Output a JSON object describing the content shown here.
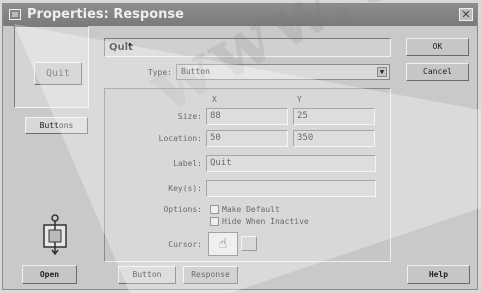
{
  "window": {
    "title": "Properties: Response",
    "close_glyph": "✕"
  },
  "left_panel": {
    "preview_label": "Quit",
    "buttons_label": "Buttons",
    "icon": "cursor-tool-icon",
    "open_label": "Open"
  },
  "form": {
    "name": "Quit",
    "type_label": "Type:",
    "type_value": "Button",
    "col_x": "X",
    "col_y": "Y",
    "size_label": "Size:",
    "size_x": "88",
    "size_y": "25",
    "location_label": "Location:",
    "location_x": "50",
    "location_y": "350",
    "label_label": "Label:",
    "label_value": "Quit",
    "keys_label": "Key(s):",
    "keys_value": "",
    "options_label": "Options:",
    "option_make_default": "Make Default",
    "option_hide_when_inactive": "Hide When Inactive",
    "cursor_label": "Cursor:",
    "cursor_icon": "hand-pointer-icon"
  },
  "tabs": {
    "button": "Button",
    "response": "Response"
  },
  "actions": {
    "ok": "OK",
    "cancel": "Cancel",
    "help": "Help"
  },
  "watermark_text": "www.u…c"
}
